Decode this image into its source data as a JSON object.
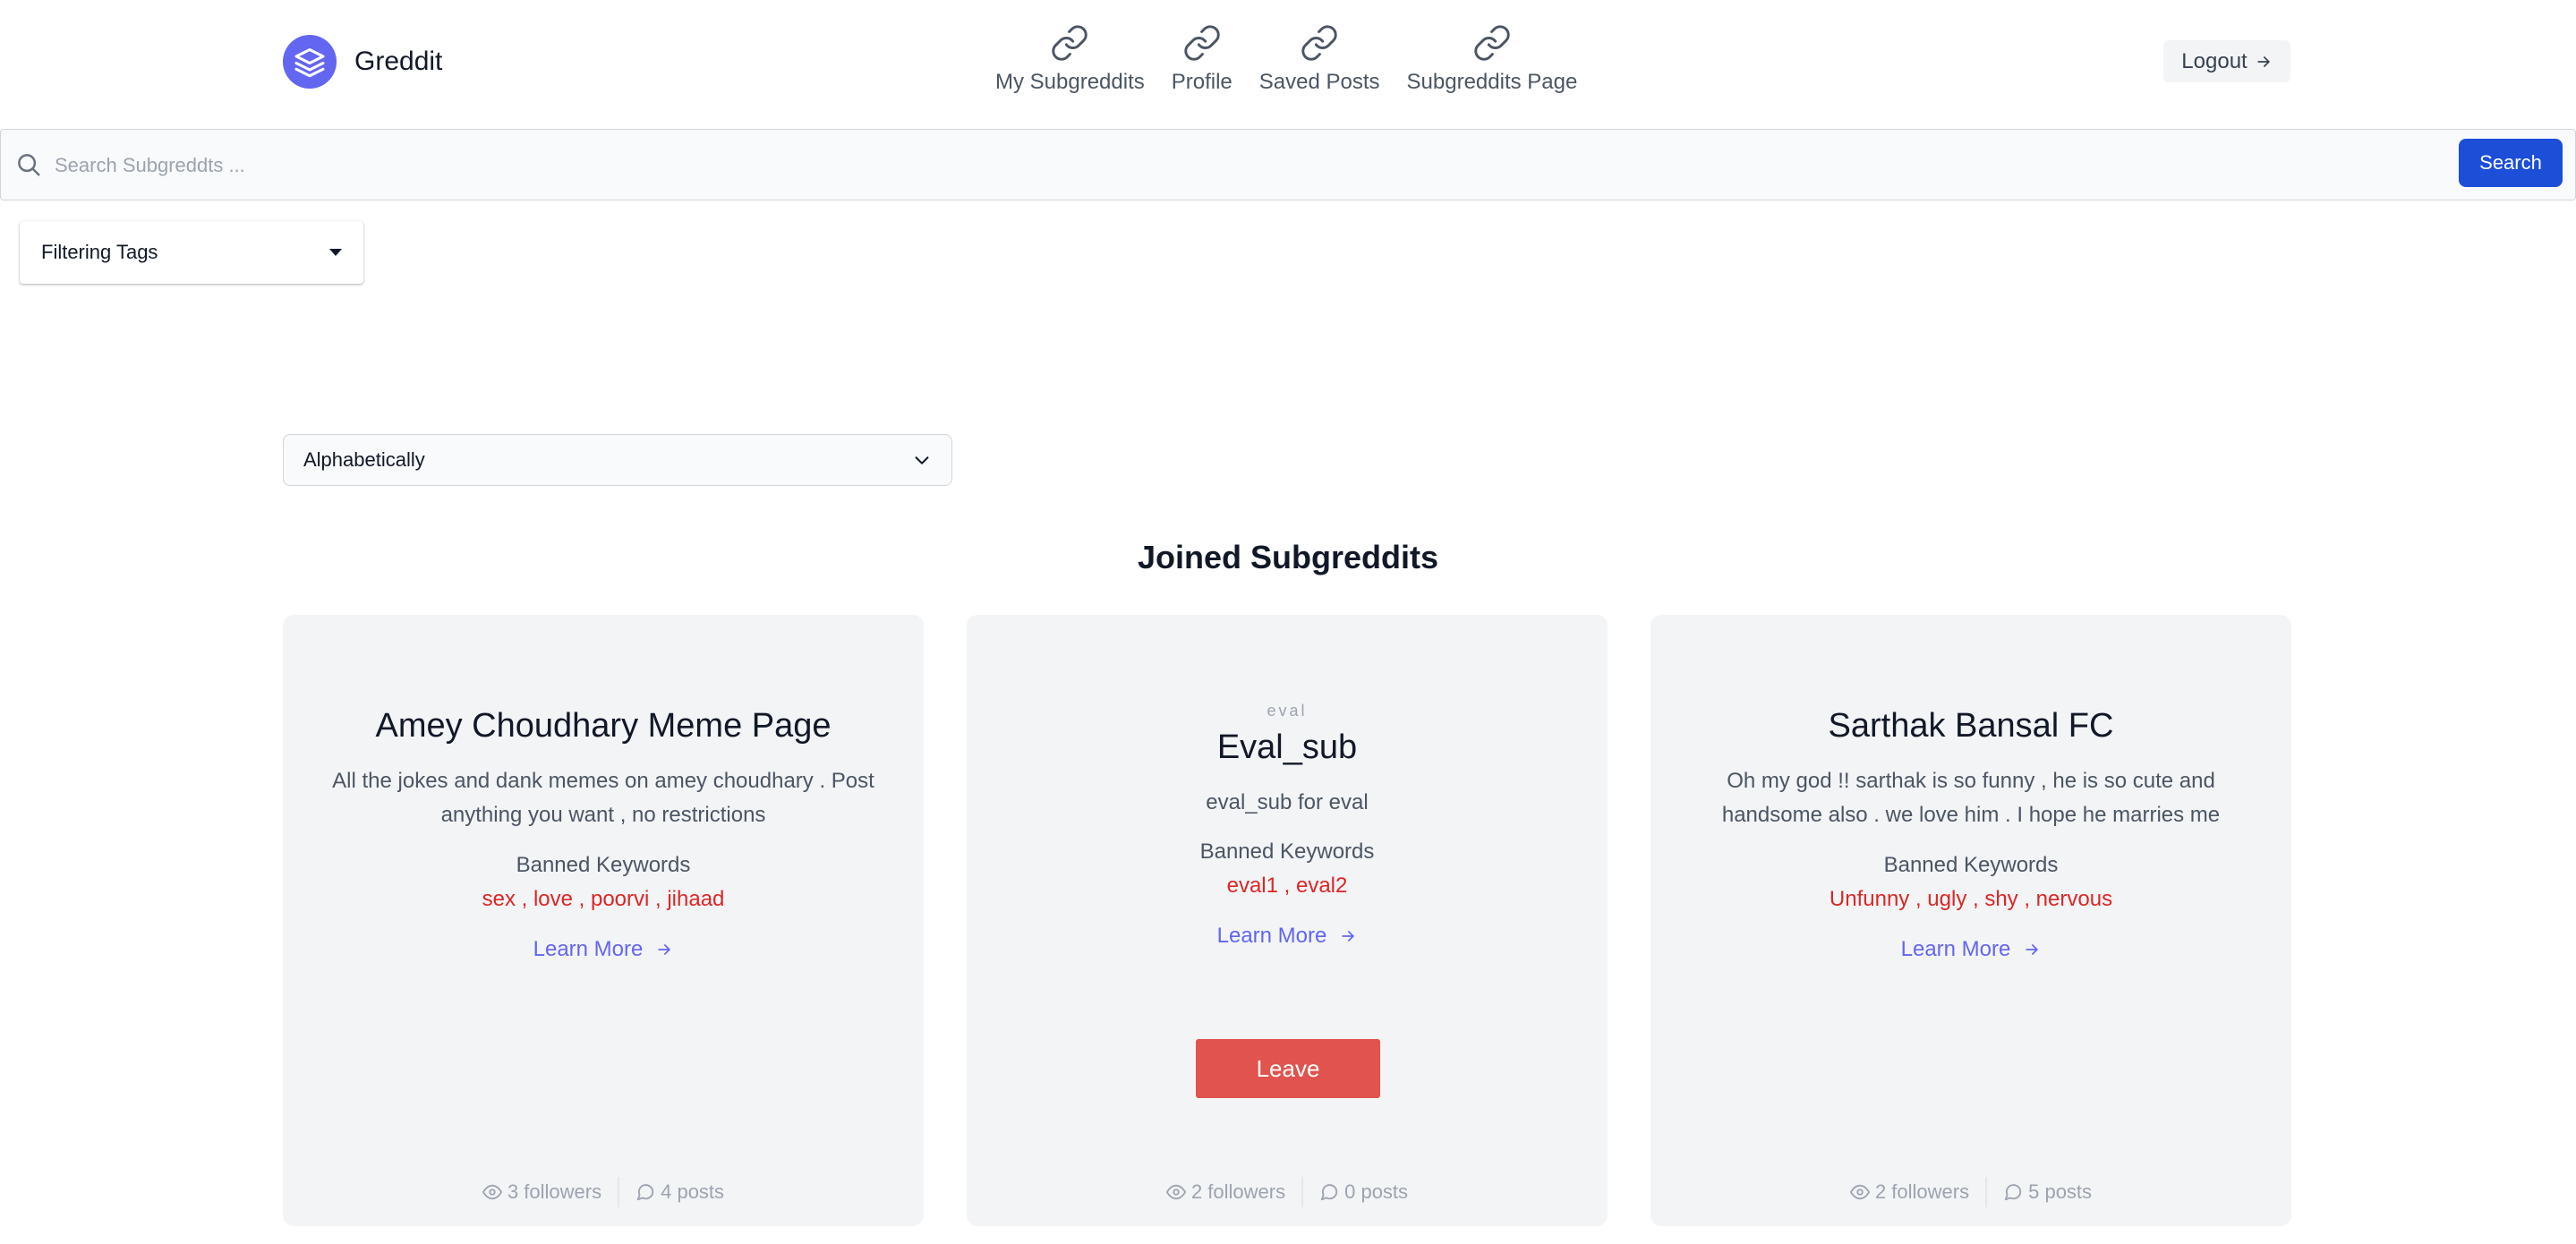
{
  "app": {
    "name": "Greddit",
    "brand_color": "#6366f1"
  },
  "nav": {
    "items": [
      {
        "label": "My Subgreddits",
        "icon": "link-icon"
      },
      {
        "label": "Profile",
        "icon": "link-icon"
      },
      {
        "label": "Saved Posts",
        "icon": "link-icon"
      },
      {
        "label": "Subgreddits Page",
        "icon": "link-icon"
      }
    ],
    "logout_label": "Logout"
  },
  "search": {
    "placeholder": "Search Subgreddts ...",
    "value": "",
    "button_label": "Search",
    "button_color": "#1d4ed8"
  },
  "filter": {
    "label": "Filtering Tags"
  },
  "sort": {
    "selected": "Alphabetically"
  },
  "section": {
    "title": "Joined Subgreddits"
  },
  "cards": [
    {
      "eyebrow": "",
      "title": "Amey Choudhary Meme Page",
      "description": "All the jokes and dank memes on amey choudhary . Post anything you want , no restrictions",
      "banned_label": "Banned Keywords",
      "banned_words": "sex , love , poorvi , jihaad",
      "learn_more": "Learn More",
      "leave_label": "",
      "followers": "3 followers",
      "posts": "4 posts"
    },
    {
      "eyebrow": "eval",
      "title": "Eval_sub",
      "description": "eval_sub for eval",
      "banned_label": "Banned Keywords",
      "banned_words": "eval1 , eval2",
      "learn_more": "Learn More",
      "leave_label": "Leave",
      "followers": "2 followers",
      "posts": "0 posts"
    },
    {
      "eyebrow": "",
      "title": "Sarthak Bansal FC",
      "description": "Oh my god !! sarthak is so funny , he is so cute and handsome also . we love him . I hope he marries me",
      "banned_label": "Banned Keywords",
      "banned_words": "Unfunny , ugly , shy , nervous",
      "learn_more": "Learn More",
      "leave_label": "",
      "followers": "2 followers",
      "posts": "5 posts"
    }
  ],
  "colors": {
    "banned": "#dc2626",
    "leave": "#e0534e",
    "card_bg": "#f3f4f6"
  }
}
